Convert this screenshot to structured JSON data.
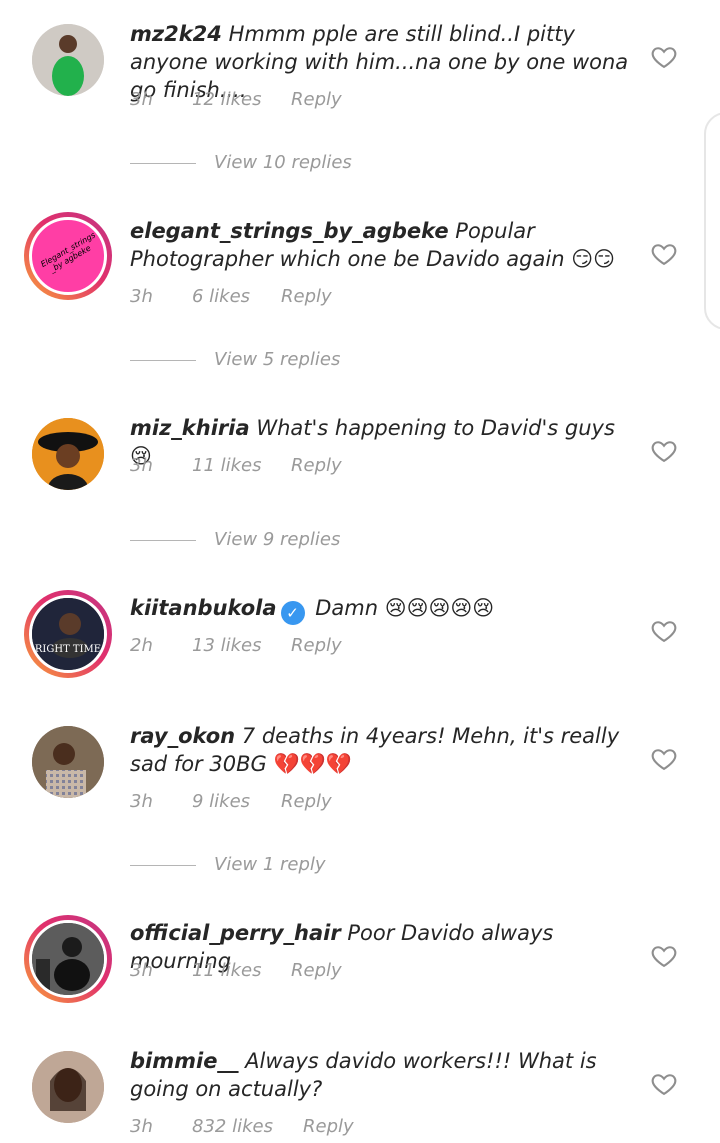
{
  "comments": [
    {
      "username": "mz2k24",
      "text": "Hmmm pple are still blind..I pitty anyone working with him...na one by one wona go finish....",
      "time": "3h",
      "likes": "12 likes",
      "reply": "Reply",
      "view_replies": "View 10 replies"
    },
    {
      "username": "elegant_strings_by_agbeke",
      "text": "Popular Photographer which one be Davido again",
      "emoji": "😏😏",
      "time": "3h",
      "likes": "6 likes",
      "reply": "Reply",
      "view_replies": "View 5 replies",
      "avatar_text": "Elegant_strings _by agbeke"
    },
    {
      "username": "miz_khiria",
      "text": "What's happening to David's guys",
      "emoji": "😢",
      "time": "3h",
      "likes": "11 likes",
      "reply": "Reply",
      "view_replies": "View 9 replies"
    },
    {
      "username": "kiitanbukola",
      "text": "Damn",
      "emoji": "😢😢😢😢😢",
      "time": "2h",
      "likes": "13 likes",
      "reply": "Reply",
      "avatar_text": "RIGHT TIME"
    },
    {
      "username": "ray_okon",
      "text": "7 deaths in 4years! Mehn, it's really sad for 30BG",
      "emoji": "💔💔💔",
      "time": "3h",
      "likes": "9 likes",
      "reply": "Reply",
      "view_replies": "View 1 reply"
    },
    {
      "username": "official_perry_hair",
      "text": "Poor Davido always mourning",
      "time": "3h",
      "likes": "11 likes",
      "reply": "Reply"
    },
    {
      "username": "bimmie__",
      "text": "Always davido workers!!! What is going on actually?",
      "time": "3h",
      "likes": "832 likes",
      "reply": "Reply"
    }
  ],
  "icons": {
    "like": "heart-outline-icon",
    "verified": "verified-badge-icon"
  },
  "colors": {
    "text": "#262626",
    "meta": "#9a9a9a",
    "story_ring": "#e1306c",
    "verified": "#3897f0"
  }
}
